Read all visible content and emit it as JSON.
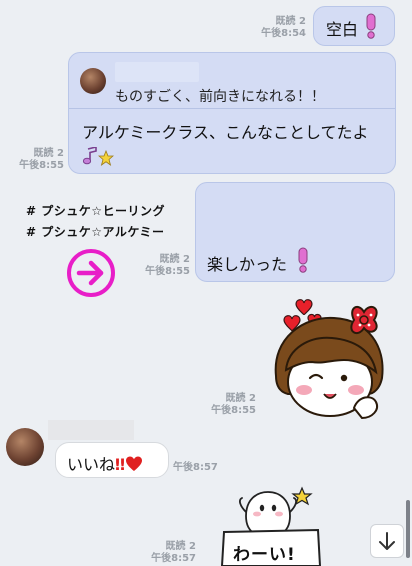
{
  "msg1": {
    "read": "既読 2",
    "time": "午後8:54",
    "text": "空白"
  },
  "msg2": {
    "read": "既読 2",
    "time": "午後8:55",
    "quote": "ものすごく、前向きになれる！！",
    "text": "アルケミークラス、こんなことしてたよ"
  },
  "overlay": {
    "line1": "# プシュケ☆ヒーリング",
    "line2": "# プシュケ☆アルケミー"
  },
  "msg3": {
    "read": "既読 2",
    "time": "午後8:55",
    "text": "楽しかった"
  },
  "sticker1": {
    "read": "既読 2",
    "time": "午後8:55"
  },
  "msg4": {
    "time": "午後8:57",
    "text": "いいね"
  },
  "sticker2": {
    "read": "既読 2",
    "time": "午後8:57",
    "text": "わーい!"
  },
  "colors": {
    "my_bubble": "#d4dcf4",
    "accent_arrow": "#e81ec8",
    "exclaim": "#e06fd0",
    "red": "#e02020"
  },
  "icons": [
    "exclamation-icon",
    "music-note-icon",
    "star-icon",
    "arrow-right-icon",
    "heart-icon",
    "scroll-down-icon"
  ]
}
